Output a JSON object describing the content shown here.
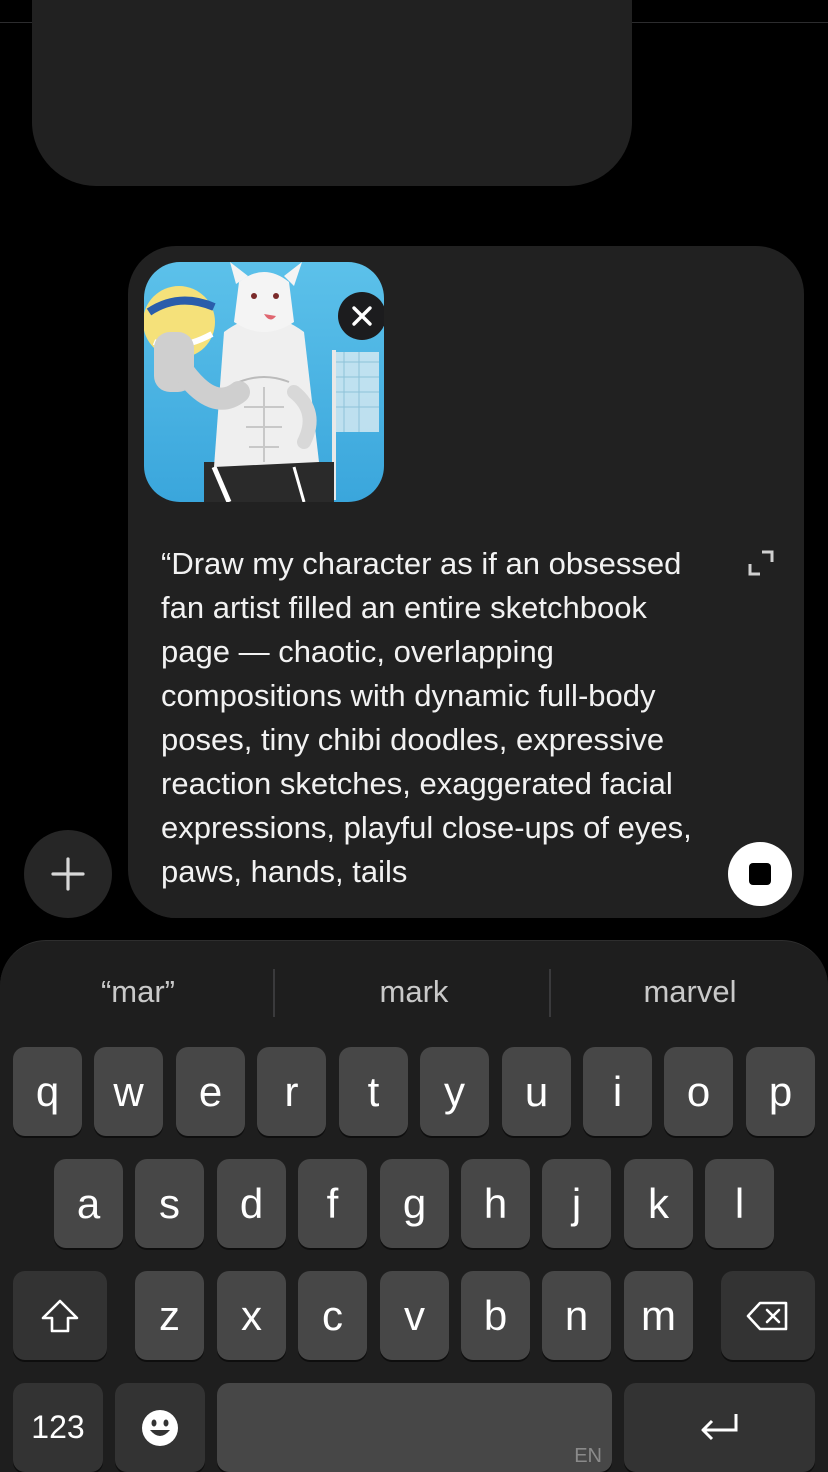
{
  "composer": {
    "prompt_text": "“Draw my character as if an obsessed fan artist filled an entire sketchbook page — chaotic, overlapping compositions with dynamic full-body poses, tiny chibi doodles, expressive reaction sketches, exaggerated facial expressions, playful close-ups of eyes, paws, hands, tails"
  },
  "keyboard": {
    "suggestions": [
      "“mar”",
      "mark",
      "marvel"
    ],
    "row1": [
      "q",
      "w",
      "e",
      "r",
      "t",
      "y",
      "u",
      "i",
      "o",
      "p"
    ],
    "row2": [
      "a",
      "s",
      "d",
      "f",
      "g",
      "h",
      "j",
      "k",
      "l"
    ],
    "row3": [
      "z",
      "x",
      "c",
      "v",
      "b",
      "n",
      "m"
    ],
    "numbers_label": "123",
    "language_label": "EN"
  },
  "icons": {
    "remove_image": "close-icon",
    "expand": "expand-icon",
    "add": "plus-icon",
    "stop": "stop-icon",
    "shift": "shift-icon",
    "delete": "backspace-icon",
    "emoji": "emoji-icon",
    "return": "return-icon"
  },
  "colors": {
    "background": "#000000",
    "bubble": "#212121",
    "key": "#474747",
    "keyboard": "#1e1e1e"
  }
}
